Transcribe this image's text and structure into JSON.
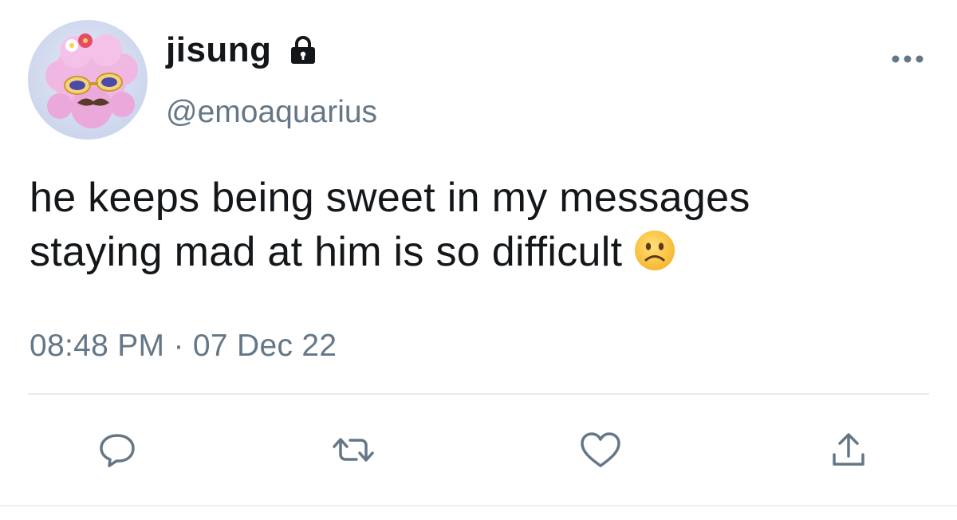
{
  "author": {
    "display_name": "jisung",
    "handle": "@emoaquarius",
    "protected": true
  },
  "tweet": {
    "text_lines": [
      "he keeps being sweet in my messages",
      "staying mad at him is so difficult"
    ],
    "emoji": "slightly-frowning-face",
    "timestamp": "08:48 PM · 07 Dec 22"
  },
  "icons": {
    "lock": "lock-icon",
    "more": "more-icon",
    "reply": "reply-icon",
    "retweet": "retweet-icon",
    "like": "heart-icon",
    "share": "share-icon"
  },
  "colors": {
    "text_primary": "#14171a",
    "text_secondary": "#657786",
    "divider": "#e6ecf0",
    "accent": "#1da1f2"
  }
}
